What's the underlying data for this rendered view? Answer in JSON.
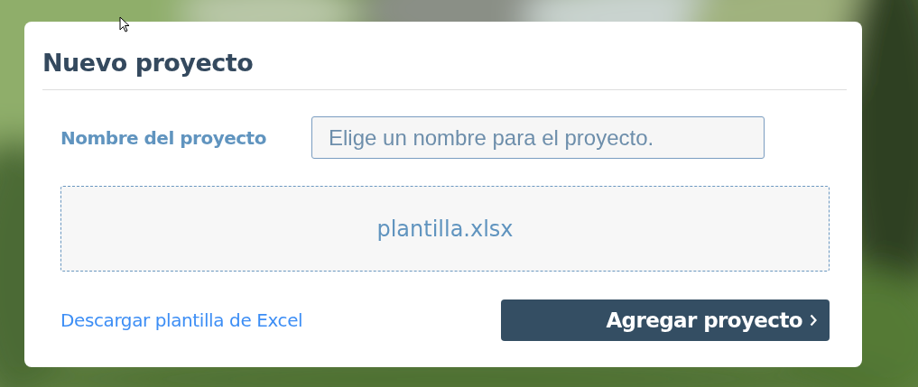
{
  "dialog": {
    "title": "Nuevo proyecto",
    "name_field": {
      "label": "Nombre del proyecto",
      "placeholder": "Elige un nombre para el proyecto."
    },
    "drop_zone": {
      "file_name": "plantilla.xlsx"
    },
    "download_link": "Descargar plantilla de Excel",
    "submit_button": "Agregar proyecto"
  }
}
